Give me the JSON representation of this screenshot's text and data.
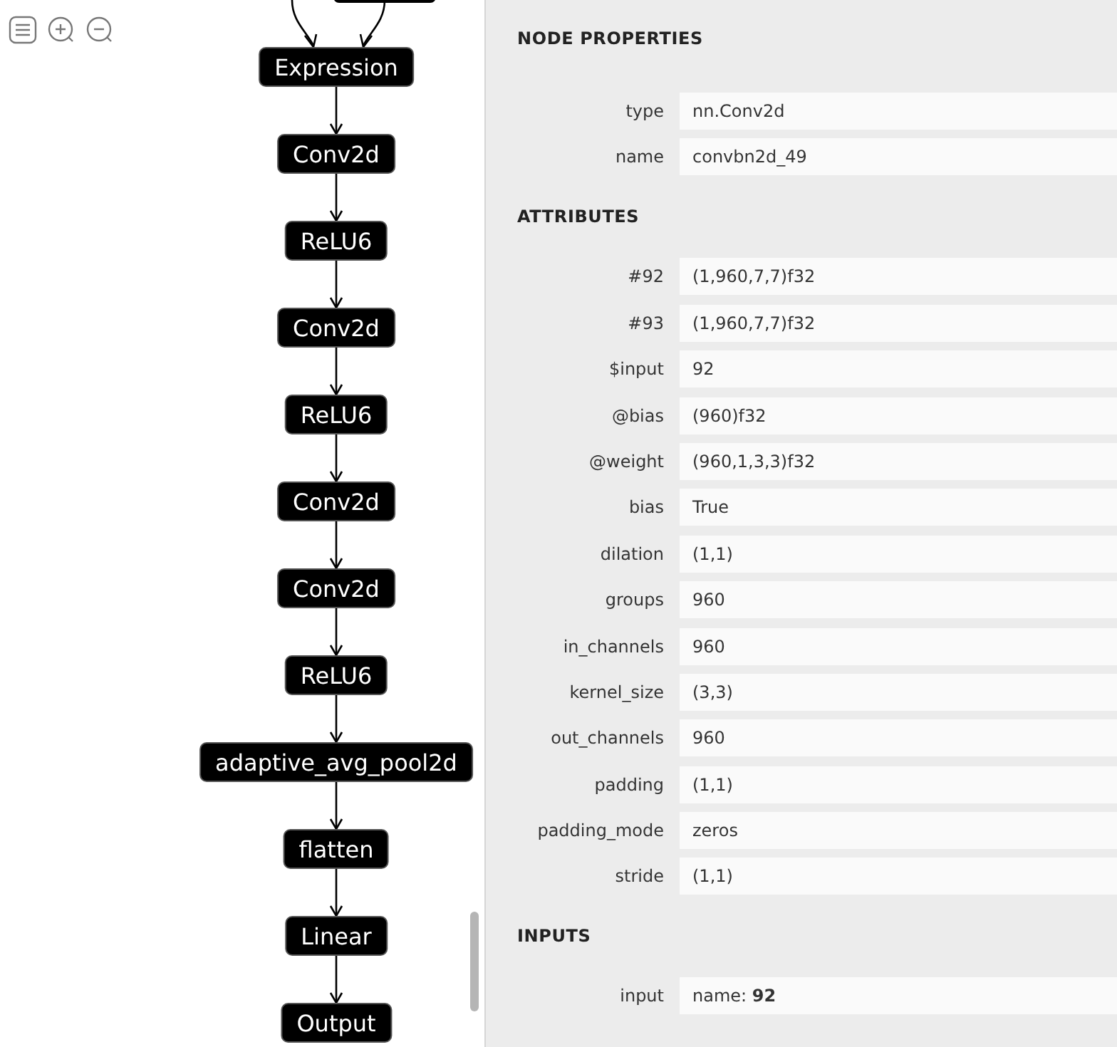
{
  "graph": {
    "nodes": [
      {
        "label": "Expression"
      },
      {
        "label": "Conv2d"
      },
      {
        "label": "ReLU6"
      },
      {
        "label": "Conv2d"
      },
      {
        "label": "ReLU6"
      },
      {
        "label": "Conv2d"
      },
      {
        "label": "Conv2d"
      },
      {
        "label": "ReLU6"
      },
      {
        "label": "adaptive_avg_pool2d"
      },
      {
        "label": "flatten"
      },
      {
        "label": "Linear"
      },
      {
        "label": "Output"
      }
    ]
  },
  "sidebar": {
    "sections": [
      {
        "title": "NODE PROPERTIES",
        "rows": [
          {
            "label": "type",
            "value": "nn.Conv2d"
          },
          {
            "label": "name",
            "value": "convbn2d_49"
          }
        ]
      },
      {
        "title": "ATTRIBUTES",
        "rows": [
          {
            "label": "#92",
            "value": "(1,960,7,7)f32"
          },
          {
            "label": "#93",
            "value": "(1,960,7,7)f32"
          },
          {
            "label": "$input",
            "value": "92"
          },
          {
            "label": "@bias",
            "value": "(960)f32"
          },
          {
            "label": "@weight",
            "value": "(960,1,3,3)f32"
          },
          {
            "label": "bias",
            "value": "True"
          },
          {
            "label": "dilation",
            "value": "(1,1)"
          },
          {
            "label": "groups",
            "value": "960"
          },
          {
            "label": "in_channels",
            "value": "960"
          },
          {
            "label": "kernel_size",
            "value": "(3,3)"
          },
          {
            "label": "out_channels",
            "value": "960"
          },
          {
            "label": "padding",
            "value": "(1,1)"
          },
          {
            "label": "padding_mode",
            "value": "zeros"
          },
          {
            "label": "stride",
            "value": "(1,1)"
          }
        ]
      },
      {
        "title": "INPUTS",
        "rows": [
          {
            "label": "input",
            "value": "name: **92**"
          }
        ]
      }
    ]
  }
}
